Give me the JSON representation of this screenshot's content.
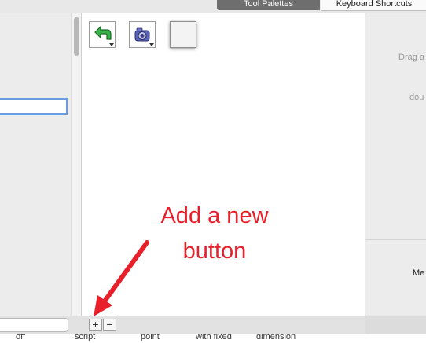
{
  "tabs": [
    {
      "label": "Tool Palettes",
      "active": true
    },
    {
      "label": "Keyboard Shortcuts",
      "active": false
    }
  ],
  "tool_buttons": [
    {
      "icon": "green-return-arrow-icon",
      "has_dropdown": true
    },
    {
      "icon": "camera-icon",
      "has_dropdown": true
    },
    {
      "icon": "blank-button-icon",
      "has_dropdown": false
    }
  ],
  "right_panel": {
    "hint_line1": "Drag a",
    "hint_line2": "dou",
    "label": "Me"
  },
  "bottom_toolbar": {
    "add_label": "+",
    "remove_label": "−"
  },
  "bottom_row_labels": [
    "off",
    "script",
    "point",
    "with fixed",
    "dimension"
  ],
  "annotation": {
    "line1": "Add a new",
    "line2": "button",
    "color": "#e8202a"
  }
}
